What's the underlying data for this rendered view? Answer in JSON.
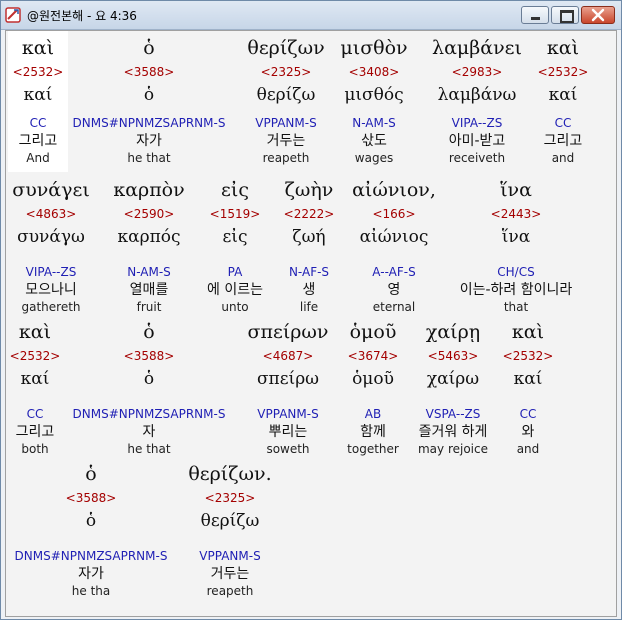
{
  "window": {
    "title": "@원전본해 - 요 4:36"
  },
  "rows": [
    {
      "words": [
        {
          "greek": "καὶ",
          "strong": "<2532>",
          "lemma": "καί",
          "morph": "CC",
          "korean": "그리고",
          "english": "And"
        },
        {
          "greek": "ὁ",
          "strong": "<3588>",
          "lemma": "ὁ",
          "morph": "DNMS#NPNMZSAPRNM-S",
          "korean": "자가",
          "english": "he that"
        },
        {
          "greek": "θερίζων",
          "strong": "<2325>",
          "lemma": "θερίζω",
          "morph": "VPPANM-S",
          "korean": "거두는",
          "english": "reapeth"
        },
        {
          "greek": "μισθὸν",
          "strong": "<3408>",
          "lemma": "μισθός",
          "morph": "N-AM-S",
          "korean": "삯도",
          "english": "wages"
        },
        {
          "greek": "λαμβάνει",
          "strong": "<2983>",
          "lemma": "λαμβάνω",
          "morph": "VIPA--ZS",
          "korean": "아미-받고",
          "english": "receiveth"
        },
        {
          "greek": "καὶ",
          "strong": "<2532>",
          "lemma": "καί",
          "morph": "CC",
          "korean": "그리고",
          "english": "and"
        }
      ]
    },
    {
      "words": [
        {
          "greek": "συνάγει",
          "strong": "<4863>",
          "lemma": "συνάγω",
          "morph": "VIPA--ZS",
          "korean": "모으나니",
          "english": "gathereth"
        },
        {
          "greek": "καρπὸν",
          "strong": "<2590>",
          "lemma": "καρπός",
          "morph": "N-AM-S",
          "korean": "열매를",
          "english": "fruit"
        },
        {
          "greek": "εἰς",
          "strong": "<1519>",
          "lemma": "εἰς",
          "morph": "PA",
          "korean": "에 이르는",
          "english": "unto"
        },
        {
          "greek": "ζωὴν",
          "strong": "<2222>",
          "lemma": "ζωή",
          "morph": "N-AF-S",
          "korean": "생",
          "english": "life"
        },
        {
          "greek": "αἰώνιον,",
          "strong": "<166>",
          "lemma": "αἰώνιος",
          "morph": "A--AF-S",
          "korean": "영",
          "english": "eternal"
        },
        {
          "greek": "ἵνα",
          "strong": "<2443>",
          "lemma": "ἵνα",
          "morph": "CH/CS",
          "korean": "이는-하려 함이니라",
          "english": "that"
        }
      ]
    },
    {
      "words": [
        {
          "greek": "καὶ",
          "strong": "<2532>",
          "lemma": "καί",
          "morph": "CC",
          "korean": "그리고",
          "english": "both"
        },
        {
          "greek": "ὁ",
          "strong": "<3588>",
          "lemma": "ὁ",
          "morph": "DNMS#NPNMZSAPRNM-S",
          "korean": "자",
          "english": "he that"
        },
        {
          "greek": "σπείρων",
          "strong": "<4687>",
          "lemma": "σπείρω",
          "morph": "VPPANM-S",
          "korean": "뿌리는",
          "english": "soweth"
        },
        {
          "greek": "ὁμοῦ",
          "strong": "<3674>",
          "lemma": "ὁμοῦ",
          "morph": "AB",
          "korean": "함께",
          "english": "together"
        },
        {
          "greek": "χαίρῃ",
          "strong": "<5463>",
          "lemma": "χαίρω",
          "morph": "VSPA--ZS",
          "korean": "즐거워 하게",
          "english": "may rejoice"
        },
        {
          "greek": "καὶ",
          "strong": "<2532>",
          "lemma": "καί",
          "morph": "CC",
          "korean": "와",
          "english": "and"
        }
      ]
    },
    {
      "words": [
        {
          "greek": "ὁ",
          "strong": "<3588>",
          "lemma": "ὁ",
          "morph": "DNMS#NPNMZSAPRNM-S",
          "korean": "자가",
          "english": "he tha"
        },
        {
          "greek": "θερίζων.",
          "strong": "<2325>",
          "lemma": "θερίζω",
          "morph": "VPPANM-S",
          "korean": "거두는",
          "english": "reapeth"
        }
      ]
    }
  ]
}
